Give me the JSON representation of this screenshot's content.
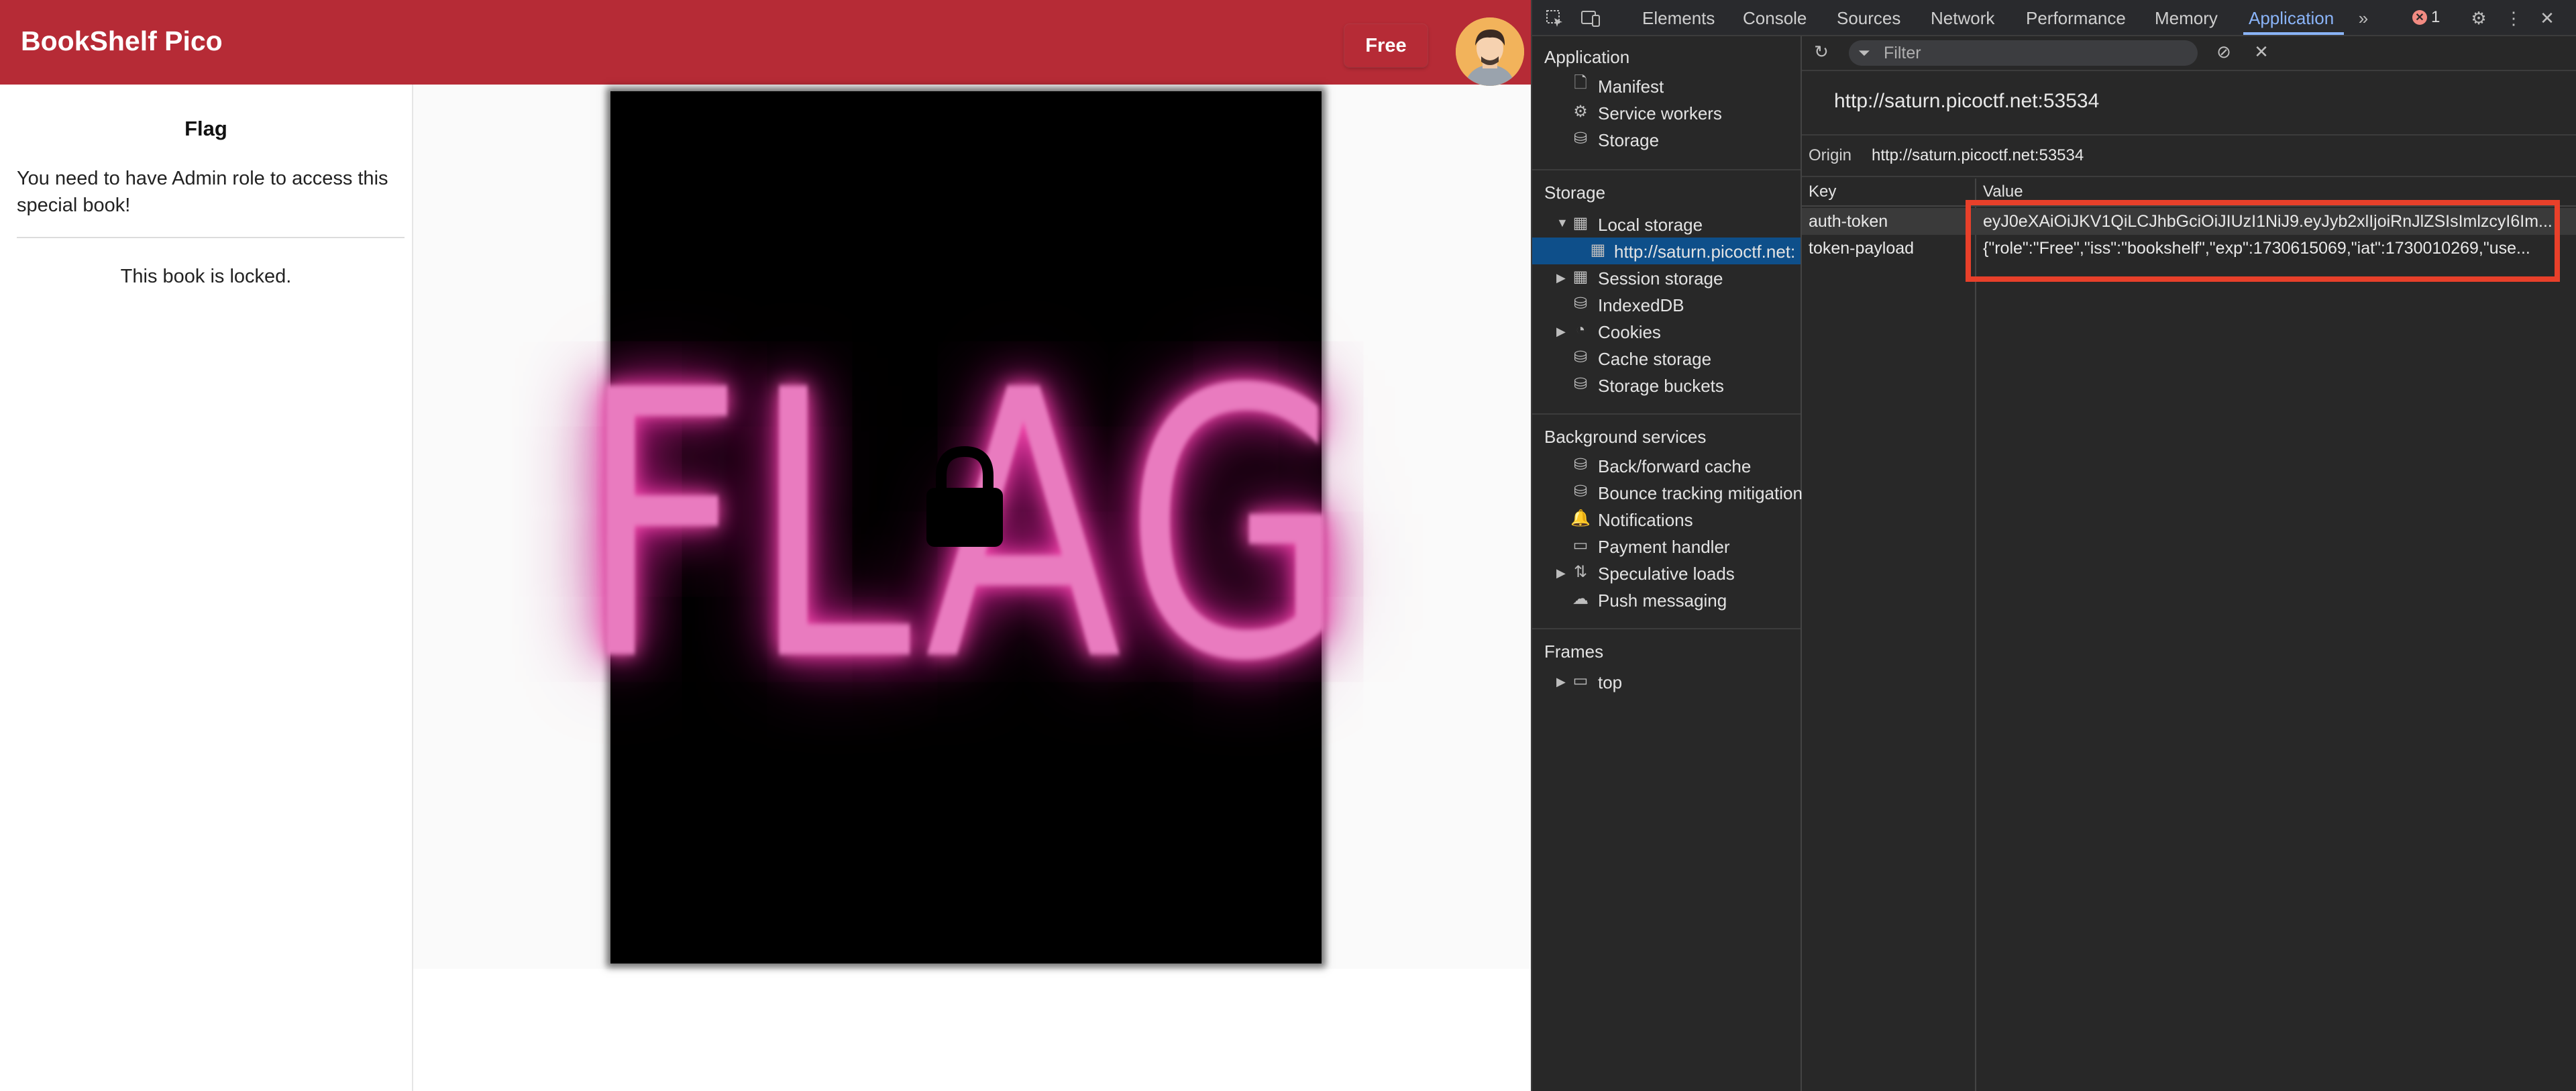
{
  "app": {
    "title": "BookShelf Pico",
    "role_button": "Free",
    "sidebar": {
      "title": "Flag",
      "message": "You need to have Admin role to access this special book!",
      "locked_text": "This book is locked."
    },
    "cover_text": "FLAG"
  },
  "devtools": {
    "tabs": [
      "Elements",
      "Console",
      "Sources",
      "Network",
      "Performance",
      "Memory",
      "Application"
    ],
    "active_tab": "Application",
    "error_count": "1",
    "nav": {
      "application_header": "Application",
      "application_items": [
        "Manifest",
        "Service workers",
        "Storage"
      ],
      "storage_header": "Storage",
      "local_storage": "Local storage",
      "local_storage_origin": "http://saturn.picoctf.net:",
      "storage_items": [
        "Session storage",
        "IndexedDB",
        "Cookies",
        "Cache storage",
        "Storage buckets"
      ],
      "background_header": "Background services",
      "background_items": [
        "Back/forward cache",
        "Bounce tracking mitigations",
        "Notifications",
        "Payment handler",
        "Speculative loads",
        "Push messaging"
      ],
      "frames_header": "Frames",
      "frames_items": [
        "top"
      ]
    },
    "filter_placeholder": "Filter",
    "origin_title": "http://saturn.picoctf.net:53534",
    "origin_label": "Origin",
    "origin_value": "http://saturn.picoctf.net:53534",
    "table": {
      "headers": [
        "Key",
        "Value"
      ],
      "rows": [
        {
          "key": "auth-token",
          "value": "eyJ0eXAiOiJKV1QiLCJhbGciOiJIUzI1NiJ9.eyJyb2xlIjoiRnJlZSIsImlzcyI6Im..."
        },
        {
          "key": "token-payload",
          "value": "{\"role\":\"Free\",\"iss\":\"bookshelf\",\"exp\":1730615069,\"iat\":1730010269,\"use..."
        }
      ]
    }
  },
  "colors": {
    "appbar": "#b62b36",
    "devtools_bg": "#282828",
    "accent": "#8ab4f8",
    "highlight_box": "#e8402a"
  }
}
